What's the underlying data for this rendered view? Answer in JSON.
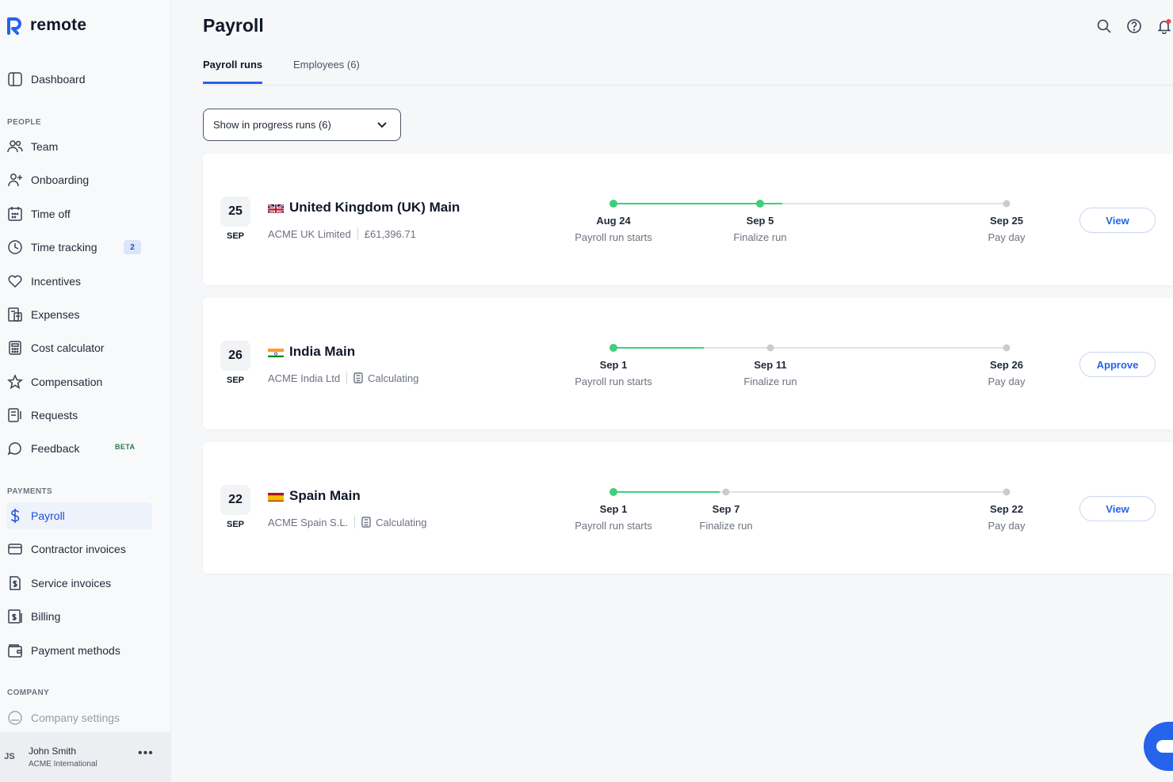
{
  "brand": {
    "name": "remote",
    "accent": "#2563eb"
  },
  "sidebar": {
    "dashboard": "Dashboard",
    "sections": {
      "people": "PEOPLE",
      "payments": "PAYMENTS",
      "company": "COMPANY"
    },
    "people_items": [
      {
        "label": "Team",
        "icon": "team-icon"
      },
      {
        "label": "Onboarding",
        "icon": "add-person-icon"
      },
      {
        "label": "Time off",
        "icon": "calendar-icon"
      },
      {
        "label": "Time tracking",
        "icon": "clock-icon",
        "badge": "2"
      },
      {
        "label": "Incentives",
        "icon": "heart-icon"
      },
      {
        "label": "Expenses",
        "icon": "receipt-icon"
      },
      {
        "label": "Cost calculator",
        "icon": "calculator-icon"
      },
      {
        "label": "Compensation",
        "icon": "star-icon"
      },
      {
        "label": "Requests",
        "icon": "requests-icon"
      },
      {
        "label": "Feedback",
        "icon": "chat-bubble-icon",
        "badge": "BETA"
      }
    ],
    "payments_items": [
      {
        "label": "Payroll",
        "icon": "dollar-icon",
        "active": true
      },
      {
        "label": "Contractor invoices",
        "icon": "invoice-icon"
      },
      {
        "label": "Service invoices",
        "icon": "service-invoice-icon"
      },
      {
        "label": "Billing",
        "icon": "billing-icon"
      },
      {
        "label": "Payment methods",
        "icon": "wallet-icon"
      }
    ],
    "company_items": [
      {
        "label": "Company settings",
        "icon": "settings-icon"
      }
    ],
    "user": {
      "initials": "JS",
      "name": "John Smith",
      "org": "ACME International"
    }
  },
  "header": {
    "title": "Payroll"
  },
  "tabs": [
    {
      "label": "Payroll runs",
      "active": true
    },
    {
      "label": "Employees (6)",
      "active": false
    }
  ],
  "filter": {
    "label": "Show in progress runs (6)"
  },
  "runs": [
    {
      "day": "25",
      "month": "SEP",
      "title": "United Kingdom (UK) Main",
      "entity": "ACME UK Limited",
      "detail": "£61,396.71",
      "detail_icon": "",
      "progress": 0.43,
      "steps": [
        {
          "date": "Aug 24",
          "label": "Payroll run starts",
          "done": true
        },
        {
          "date": "Sep 5",
          "label": "Finalize run",
          "done": true
        },
        {
          "date": "Sep 25",
          "label": "Pay day",
          "done": false
        }
      ],
      "action": "View"
    },
    {
      "day": "26",
      "month": "SEP",
      "title": "India Main",
      "entity": "ACME India Ltd",
      "detail": "Calculating",
      "detail_icon": "calculator-icon",
      "progress": 0.23,
      "steps": [
        {
          "date": "Sep 1",
          "label": "Payroll run starts",
          "done": true
        },
        {
          "date": "Sep 11",
          "label": "Finalize run",
          "done": false
        },
        {
          "date": "Sep 26",
          "label": "Pay day",
          "done": false
        }
      ],
      "action": "Approve"
    },
    {
      "day": "22",
      "month": "SEP",
      "title": "Spain Main",
      "entity": "ACME Spain S.L.",
      "detail": "Calculating",
      "detail_icon": "calculator-icon",
      "progress": 0.27,
      "steps": [
        {
          "date": "Sep 1",
          "label": "Payroll run starts",
          "done": true
        },
        {
          "date": "Sep 7",
          "label": "Finalize run",
          "done": false
        },
        {
          "date": "Sep 22",
          "label": "Pay day",
          "done": false
        }
      ],
      "action": "View"
    }
  ],
  "colors": {
    "done": "#3ecf7a",
    "pending": "#c9ccd2",
    "track": "#dfe2e6"
  }
}
